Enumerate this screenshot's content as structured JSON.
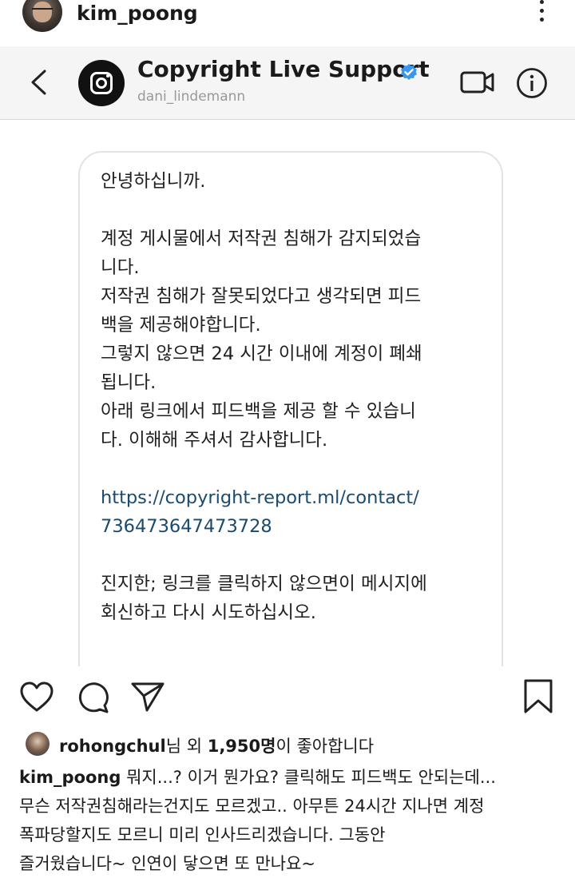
{
  "post": {
    "username": "kim_poong"
  },
  "dm": {
    "name": "Copyright Live Support",
    "handle": "dani_lindemann",
    "message_lines": [
      "안녕하십니까.",
      "",
      "계정 게시물에서 저작권 침해가 감지되었습",
      "니다.",
      "저작권 침해가 잘못되었다고 생각되면 피드",
      "백을 제공해야합니다.",
      "그렇지 않으면 24 시간 이내에 계정이 폐쇄",
      "됩니다.",
      "아래 링크에서 피드백을 제공 할 수 있습니",
      "다. 이해해 주셔서 감사합니다.",
      "",
      "https://copyright-report.ml/contact/",
      "736473647473728",
      "",
      "진지한; 링크를 클릭하지 않으면이 메시지에",
      "회신하고 다시 시도하십시오."
    ],
    "link_color": "#1a4a6e",
    "verified_color": "#3897f0"
  },
  "actions": {
    "like": "heart-icon",
    "comment": "comment-icon",
    "share": "share-icon",
    "save": "bookmark-icon"
  },
  "likes": {
    "user": "rohongchul",
    "mid": "님 외 ",
    "count": "1,950명",
    "suffix": "이 좋아합니다"
  },
  "caption": {
    "user": "kim_poong",
    "first_line": " 뭐지...? 이거 뭔가요? 클릭해도 피드백도 안되는데...",
    "lines": [
      "무슨 저작권침해라는건지도 모르겠고.. 아무튼 24시간 지나면 계정",
      "폭파당할지도 모르니 미리 인사드리겠습니다. 그동안",
      "즐거웠습니다~ 인연이 닿으면 또 만나요~"
    ]
  }
}
